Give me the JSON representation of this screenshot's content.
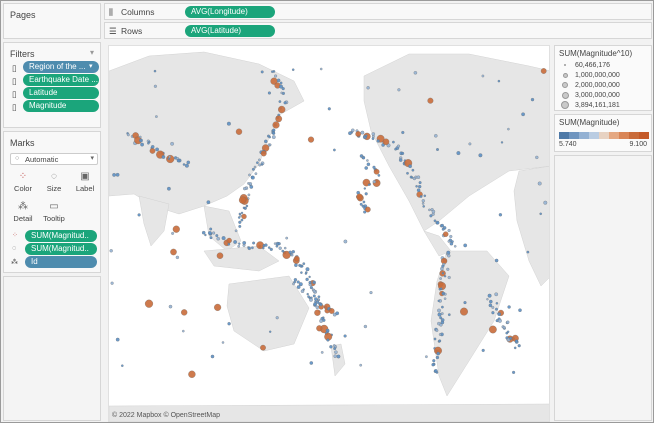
{
  "pages": {
    "title": "Pages"
  },
  "columns": {
    "label": "Columns",
    "pill": "AVG(Longitude)"
  },
  "rows": {
    "label": "Rows",
    "pill": "AVG(Latitude)"
  },
  "filters": {
    "title": "Filters",
    "items": [
      {
        "label": "Region of the ...",
        "color": "#4e8cae"
      },
      {
        "label": "Earthquake Date ...",
        "color": "#1ba57b"
      },
      {
        "label": "Latitude",
        "color": "#1ba57b"
      },
      {
        "label": "Magnitude",
        "color": "#1ba57b"
      }
    ]
  },
  "marks": {
    "title": "Marks",
    "type_select": "Automatic",
    "buttons": {
      "color": "Color",
      "size": "Size",
      "label": "Label",
      "detail": "Detail",
      "tooltip": "Tooltip"
    },
    "fields": [
      {
        "label": "SUM(Magnitud..",
        "icon": "color-dots-icon",
        "color": "#1ba57b"
      },
      {
        "label": "SUM(Magnitud..",
        "icon": "size-icon",
        "color": "#1ba57b"
      },
      {
        "label": "Id",
        "icon": "detail-icon",
        "color": "#4e8cae"
      }
    ]
  },
  "legend_size": {
    "title": "SUM(Magnitude^10)",
    "entries": [
      "60,466,176",
      "1,000,000,000",
      "2,000,000,000",
      "3,000,000,000",
      "3,894,161,181"
    ]
  },
  "legend_color": {
    "title": "SUM(Magnitude)",
    "min": "5.740",
    "max": "9.100",
    "color_low": "#4e79a7",
    "color_high": "#c45a28"
  },
  "map": {
    "attribution": "© 2022 Mapbox © OpenStreetMap"
  }
}
